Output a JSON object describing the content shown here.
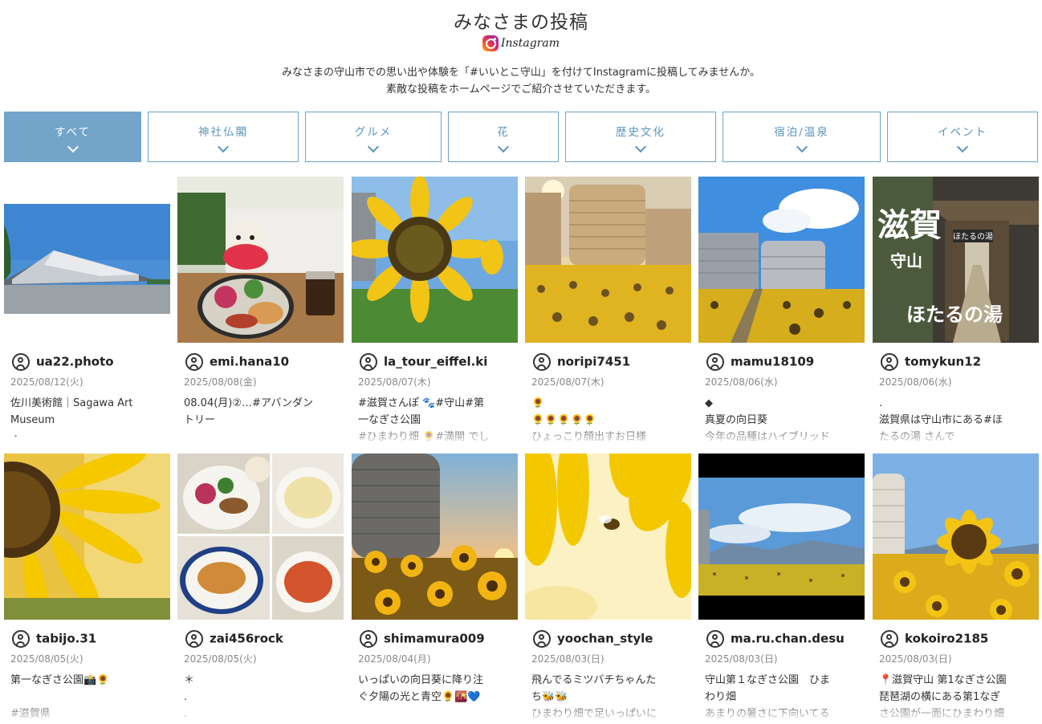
{
  "header": {
    "title": "みなさまの投稿",
    "instagram_word": "Instagram",
    "intro_line1": "みなさまの守山市での思い出や体験を「#いいとこ守山」を付けてInstagramに投稿してみませんか。",
    "intro_line2": "素敵な投稿をホームページでご紹介させていただきます。"
  },
  "tabs": [
    {
      "label": "すべて",
      "active": true
    },
    {
      "label": "神社仏閣",
      "active": false
    },
    {
      "label": "グルメ",
      "active": false
    },
    {
      "label": "花",
      "active": false
    },
    {
      "label": "歴史文化",
      "active": false
    },
    {
      "label": "宿泊/温泉",
      "active": false
    },
    {
      "label": "イベント",
      "active": false
    }
  ],
  "posts": [
    {
      "user": "ua22.photo",
      "date": "2025/08/12(火)",
      "caption": "佐川美術館｜Sagawa Art\nMuseum\n・"
    },
    {
      "user": "emi.hana10",
      "date": "2025/08/08(金)",
      "caption": "08.04(月)②…#アバンダン\nトリー"
    },
    {
      "user": "la_tour_eiffel.ki",
      "date": "2025/08/07(木)",
      "caption": "#滋賀さんぽ 🐾#守山#第\n一なぎさ公園\n#ひまわり畑 🌻#満開 でし"
    },
    {
      "user": "noripi7451",
      "date": "2025/08/07(木)",
      "caption": "🌻\n🌻🌻🌻🌻🌻\nひょっこり顔出すお日様"
    },
    {
      "user": "mamu18109",
      "date": "2025/08/06(水)",
      "caption": "◆\n真夏の向日葵\n今年の品種はハイブリッド"
    },
    {
      "user": "tomykun12",
      "date": "2025/08/06(水)",
      "caption": ".\n滋賀県は守山市にある#ほ\nたるの湯 さんで"
    },
    {
      "user": "tabijo.31",
      "date": "2025/08/05(火)",
      "caption": "第一なぎさ公園📸🌻\n\n#滋賀県"
    },
    {
      "user": "zai456rock",
      "date": "2025/08/05(火)",
      "caption": "＊\n.\n."
    },
    {
      "user": "shimamura009",
      "date": "2025/08/04(月)",
      "caption": "いっぱいの向日葵に降り注\nぐ夕陽の光と青空🌻🌇💙"
    },
    {
      "user": "yoochan_style",
      "date": "2025/08/03(日)",
      "caption": "飛んでるミツバチちゃんた\nち🐝🐝\nひまわり畑で足いっぱいに"
    },
    {
      "user": "ma.ru.chan.desu",
      "date": "2025/08/03(日)",
      "caption": "守山第１なぎさ公園　ひま\nわり畑\nあまりの暑さに下向いてる"
    },
    {
      "user": "kokoiro2185",
      "date": "2025/08/03(日)",
      "caption": "📍滋賀守山 第1なぎさ公園\n琵琶湖の横にある第1なぎ\nさ公園が一面にひまわり畑"
    }
  ],
  "photo6_overlay": {
    "line1": "滋賀",
    "line2": "守山",
    "line3": "ほたるの湯",
    "sign": "ほたるの湯"
  },
  "colors": {
    "tab_border": "#6fa3c6",
    "tab_active_bg": "#72a5c9",
    "tab_text": "#5b94bb"
  }
}
